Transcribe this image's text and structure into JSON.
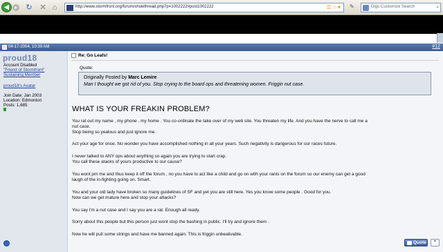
{
  "browser": {
    "url": "http://www.stormfront.org/forum/showthread.php?p=1002222#post1002222",
    "search_placeholder": "Digo Customize Search"
  },
  "post": {
    "date": "04-17-2004, 10:39 AM",
    "number": "#12",
    "title": "Re: Go Leafs!",
    "quote": {
      "label": "Quote:",
      "prefix": "Originally Posted by ",
      "author": "Marc Lemire",
      "text": "Man I thought we got rid of you. Stop crying to the board ops and threatening women. Friggin nut case."
    },
    "headline": "WHAT IS YOUR FREAKIN PROBLEM?",
    "lines": [
      "You rat out my name , my phone , my home . You co-ordinate the take over of my web site. You threaten my life. And you have the nerve to call me a",
      "nut case.",
      "Stop being so yealous and just ignore me.",
      "Act your age for once. No wonder you have accomplished nothing in all your years. Such negativity is dangerous for our races future.",
      "I never talked to ANY ops about anything so again you are trying to start crap.",
      "You call these atacks of yours productive to our cause?",
      "You wont pm me and thus keep it off the forum , no you have to act like a child and go on with your rants on the forum so our enemy can get a good",
      "laugh of the in-fighting going on. Smart.",
      "You and your old lady have broken so many guidelines of SF and yet you are still here. Yes you know some people . Good for you.",
      "Now can we get mature here and stop your attacks?",
      "You say i'm a nut case and I say you are a rat. Enough all ready.",
      "Sorry about this people but this person just wont stop the bashing in public. I'll try and ignore them .",
      "Now he will pull some strings and have me banned again. This is friggin unbealivable."
    ],
    "quote_button": "Quote"
  },
  "user": {
    "name": "proud18",
    "status": "Account Disabled",
    "title1": "\"Friend of Stormfront\"",
    "title2": "Sustaining Member",
    "avatar_link": "proud18's Avatar",
    "join_date": "Join Date: Jan 2003",
    "location": "Location: Edmonton",
    "posts": "Posts: 1,685"
  }
}
